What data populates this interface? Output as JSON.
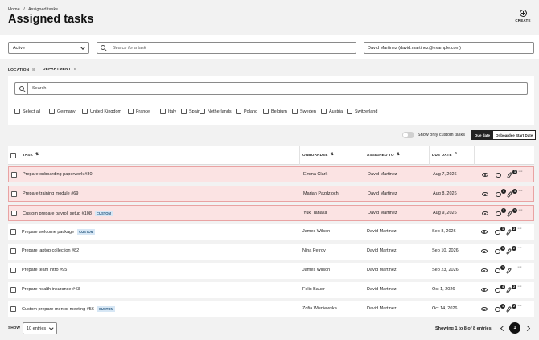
{
  "breadcrumb": {
    "home": "Home",
    "sep": "/",
    "current": "Assigned tasks"
  },
  "page_title": "Assigned tasks",
  "create_label": "CREATE",
  "filters": {
    "status": "Active",
    "task_search_placeholder": "Search for a task",
    "user": "David Martinez (david.martinez@example.com)"
  },
  "tabs": [
    {
      "label": "LOCATION",
      "count": "8"
    },
    {
      "label": "DEPARTMENT",
      "count": "8"
    }
  ],
  "location_search_placeholder": "Search",
  "countries": [
    "Select all",
    "Germany",
    "United Kingdom",
    "France",
    "Italy",
    "Spain",
    "Netherlands",
    "Poland",
    "Belgium",
    "Sweden",
    "Austria",
    "Switzerland"
  ],
  "custom_toggle_label": "Show only custom tasks",
  "sort_buttons": {
    "due_date": "Due date",
    "start_date": "Onboardee Start Date"
  },
  "columns": {
    "task": "TASK",
    "onboardee": "ONBOARDEE",
    "assigned_to": "ASSIGNED TO",
    "due_date": "DUE DATE"
  },
  "rows": [
    {
      "task": "Prepare onboarding paperwork #30",
      "custom": "",
      "onboardee": "Emma Clark",
      "assigned": "David Martinez",
      "due": "Aug 7, 2026",
      "comments": "",
      "attachments": "1",
      "overdue": true
    },
    {
      "task": "Prepare training module #69",
      "custom": "",
      "onboardee": "Marian Pazdzioch",
      "assigned": "David Martinez",
      "due": "Aug 8, 2026",
      "comments": "1",
      "attachments": "1",
      "overdue": true
    },
    {
      "task": "Custom prepare payroll setup #108",
      "custom": "CUSTOM",
      "onboardee": "Yuki Tanaka",
      "assigned": "David Martinez",
      "due": "Aug 9, 2026",
      "comments": "1",
      "attachments": "1",
      "overdue": true
    },
    {
      "task": "Prepare welcome package",
      "custom": "CUSTOM",
      "onboardee": "James Wilson",
      "assigned": "David Martinez",
      "due": "Sep 8, 2026",
      "comments": "1",
      "attachments": "2",
      "overdue": false
    },
    {
      "task": "Prepare laptop collection #82",
      "custom": "",
      "onboardee": "Nina Petrov",
      "assigned": "David Martinez",
      "due": "Sep 10, 2026",
      "comments": "1",
      "attachments": "2",
      "overdue": false
    },
    {
      "task": "Prepare team intro #95",
      "custom": "",
      "onboardee": "James Wilson",
      "assigned": "David Martinez",
      "due": "Sep 23, 2026",
      "comments": "1",
      "attachments": "",
      "overdue": false
    },
    {
      "task": "Prepare health insurance #43",
      "custom": "",
      "onboardee": "Felix Bauer",
      "assigned": "David Martinez",
      "due": "Oct 1, 2026",
      "comments": "4",
      "attachments": "2",
      "overdue": false
    },
    {
      "task": "Custom prepare mentor meeting #56",
      "custom": "CUSTOM",
      "onboardee": "Zofia Wisniewska",
      "assigned": "David Martinez",
      "due": "Oct 14, 2026",
      "comments": "1",
      "attachments": "2",
      "overdue": false
    }
  ],
  "footer": {
    "show_label": "SHOW",
    "entries": "10 entries",
    "showing": "Showing 1 to 8 of 8 entries",
    "current_page": "1"
  },
  "colors": {
    "overdue_bg": "#fbe3e3",
    "overdue_border": "#e9a3a3",
    "tag_bg": "#d7e7f5"
  }
}
